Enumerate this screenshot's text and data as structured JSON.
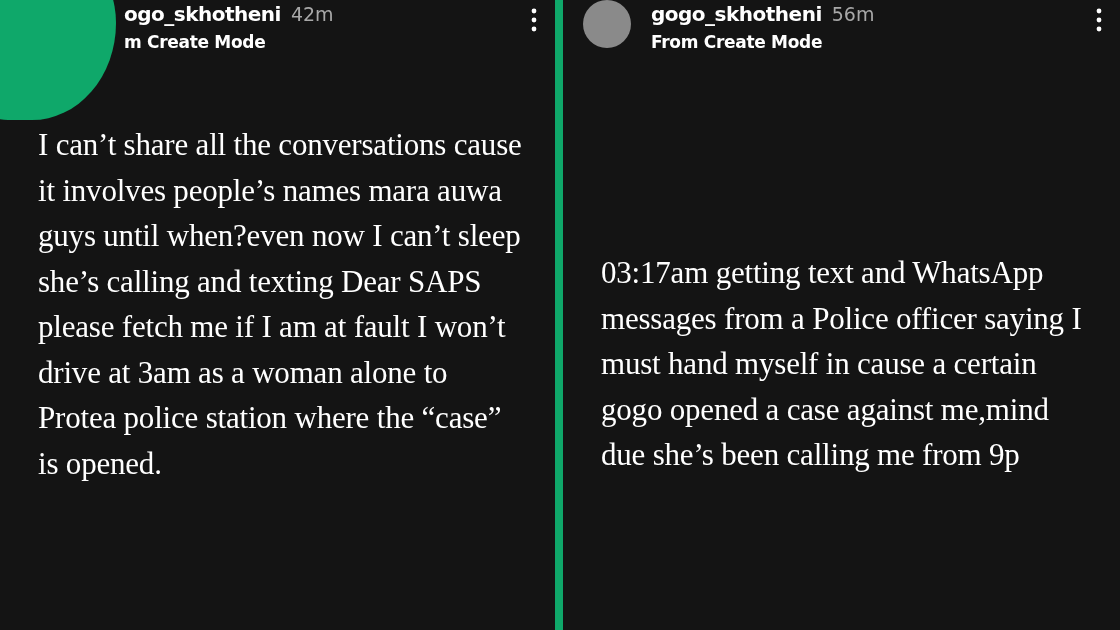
{
  "stories": [
    {
      "username": "ogo_skhotheni",
      "time": "42m",
      "subtitle": "m Create Mode",
      "avatar": false,
      "text": "I can’t share all the conversations cause it involves people’s names mara auwa guys until when?even now I can’t sleep she’s calling and texting Dear SAPS please fetch me if I am at fault I won’t drive at 3am as a woman alone to Protea police station where the “case” is opened."
    },
    {
      "username": "gogo_skhotheni",
      "time": "56m",
      "subtitle": "From Create Mode",
      "avatar": true,
      "text": "03:17am getting text and WhatsApp messages from a Police officer saying I must hand myself in cause a certain gogo opened a case against me,mind due she’s been calling me from 9p"
    }
  ]
}
